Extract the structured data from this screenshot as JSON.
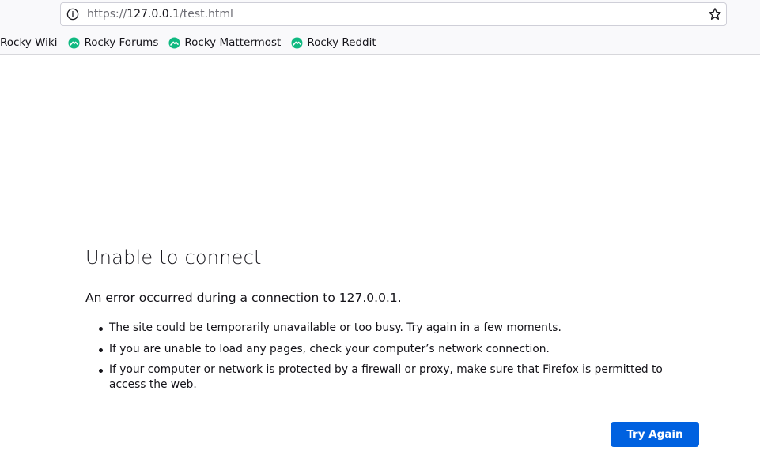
{
  "browser": {
    "url": {
      "scheme": "https://",
      "host": "127.0.0.1",
      "path": "/test.html"
    },
    "bookmarks": [
      {
        "label": "Rocky Wiki",
        "icon": "none"
      },
      {
        "label": "Rocky Forums",
        "icon": "rocky-logo-icon"
      },
      {
        "label": "Rocky Mattermost",
        "icon": "rocky-logo-icon"
      },
      {
        "label": "Rocky Reddit",
        "icon": "rocky-logo-icon"
      }
    ],
    "colors": {
      "rocky_green": "#10b981",
      "primary_button": "#0061e0"
    }
  },
  "error_page": {
    "title": "Unable to connect",
    "description": "An error occurred during a connection to 127.0.0.1.",
    "tips": [
      "The site could be temporarily unavailable or too busy. Try again in a few moments.",
      "If you are unable to load any pages, check your computer’s network connection.",
      "If your computer or network is protected by a firewall or proxy, make sure that Firefox is permitted to access the web."
    ],
    "button_label": "Try Again"
  }
}
